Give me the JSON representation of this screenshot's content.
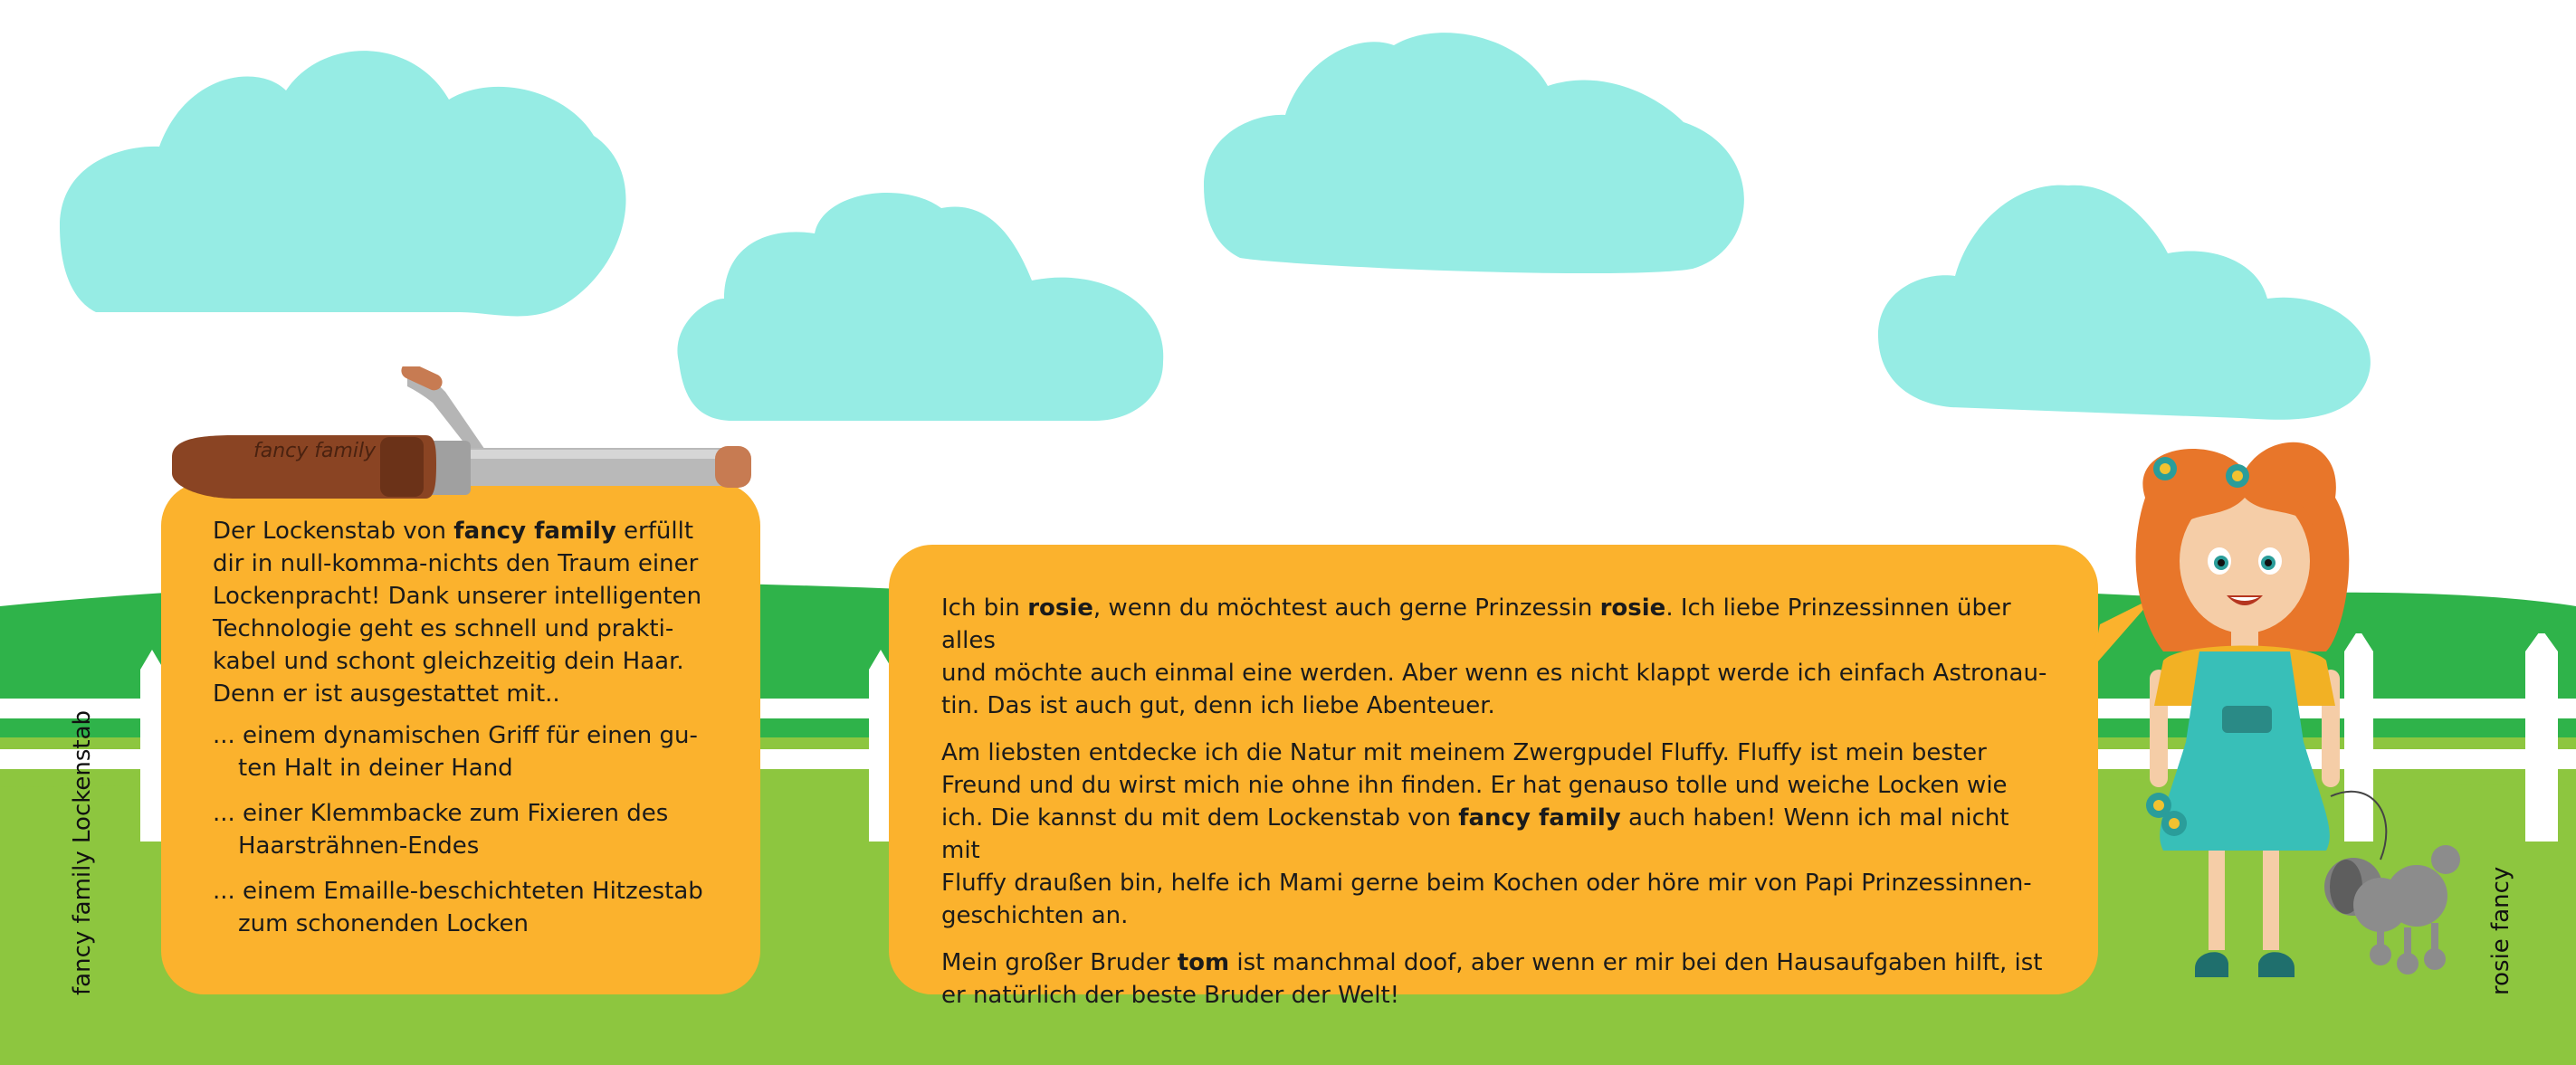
{
  "colors": {
    "sky": "#ffffff",
    "cloud": "#96ece4",
    "grass_dark": "#2fb34a",
    "grass_light": "#8dc63f",
    "fence": "#ffffff",
    "card": "#fbb22d",
    "text": "#1b1b1b"
  },
  "icons": {
    "curler": "curling-iron-icon",
    "girl": "girl-character-icon",
    "poodle": "poodle-icon"
  },
  "curler": {
    "brand": "fancy family"
  },
  "product": {
    "intro": {
      "prefix": "Der Lockenstab von ",
      "brand": "fancy family",
      "line1_suffix": " erfüllt",
      "line2": "dir in null-komma-nichts den Traum einer",
      "line3": "Lockenpracht! Dank unserer intelligenten",
      "line4": "Technologie geht es schnell und prakti-",
      "line5": "kabel und schont gleichzeitig dein Haar.",
      "line6": "Denn er ist ausgestattet mit.."
    },
    "features": [
      {
        "line1": "... einem dynamischen Griff für einen gu-",
        "line2": "ten Halt in deiner Hand"
      },
      {
        "line1": "... einer Klemmbacke zum Fixieren des",
        "line2": "Haarsträhnen-Endes"
      },
      {
        "line1": "... einem Emaille-beschichteten Hitzestab",
        "line2": "zum schonenden Locken"
      }
    ],
    "side_label": "fancy family Lockenstab"
  },
  "story": {
    "p1": {
      "a": "Ich bin ",
      "name1": "rosie",
      "b": ", wenn du möchtest auch gerne Prinzessin ",
      "name2": "rosie",
      "c": ". Ich liebe Prinzessinnen über alles",
      "line2": "und möchte auch einmal eine werden. Aber wenn es nicht klappt werde ich einfach Astronau-",
      "line3": "tin. Das ist auch gut, denn ich liebe Abenteuer."
    },
    "p2": {
      "line1": "Am liebsten entdecke ich die Natur mit meinem Zwergpudel Fluffy. Fluffy ist mein bester",
      "line2": "Freund und du wirst mich nie ohne ihn finden. Er hat genauso tolle und weiche Locken wie",
      "line3_a": "ich. Die kannst du mit dem Lockenstab von ",
      "line3_brand": "fancy family",
      "line3_b": " auch haben! Wenn ich mal nicht mit",
      "line4": "Fluffy draußen bin, helfe ich Mami gerne beim Kochen oder höre mir von Papi Prinzessinnen-",
      "line5": "geschichten an."
    },
    "p3": {
      "a": "Mein großer Bruder ",
      "name": "tom",
      "b": " ist manchmal doof, aber wenn er mir bei den Hausaufgaben hilft, ist",
      "line2": "er natürlich der beste Bruder der Welt!"
    },
    "side_label": "rosie fancy"
  }
}
